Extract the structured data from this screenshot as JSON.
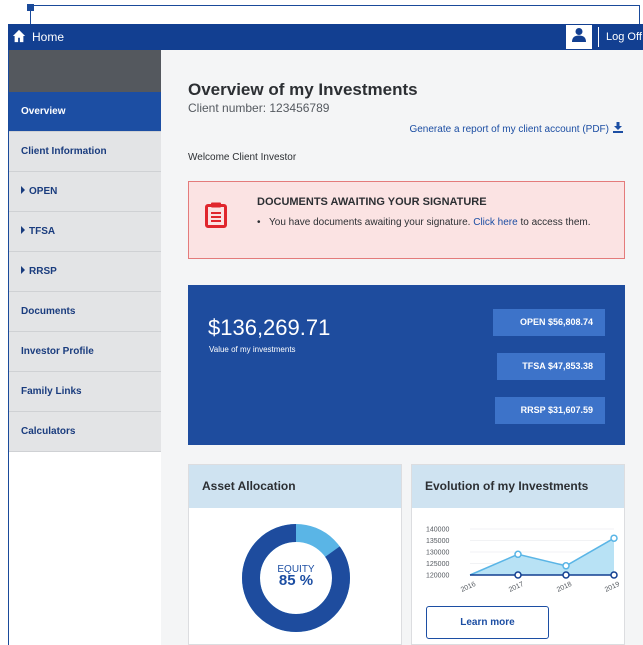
{
  "topbar": {
    "home_label": "Home",
    "logoff_label": "Log Off",
    "icon_home": "home-icon",
    "icon_user": "user-icon"
  },
  "sidebar": {
    "items": [
      {
        "label": "Overview",
        "active": true,
        "caret": false
      },
      {
        "label": "Client Information",
        "active": false,
        "caret": false
      },
      {
        "label": "OPEN",
        "active": false,
        "caret": true
      },
      {
        "label": "TFSA",
        "active": false,
        "caret": true
      },
      {
        "label": "RRSP",
        "active": false,
        "caret": true
      },
      {
        "label": "Documents",
        "active": false,
        "caret": false
      },
      {
        "label": "Investor Profile",
        "active": false,
        "caret": false
      },
      {
        "label": "Family Links",
        "active": false,
        "caret": false
      },
      {
        "label": "Calculators",
        "active": false,
        "caret": false
      }
    ]
  },
  "main": {
    "title": "Overview of my Investments",
    "client_number": "Client number: 123456789",
    "report_link": "Generate a report of my client account (PDF)",
    "welcome": "Welcome Client Investor"
  },
  "alert": {
    "title": "DOCUMENTS AWAITING YOUR SIGNATURE",
    "text_before": "You have documents awaiting your signature.",
    "link": "Click here",
    "text_after": "to access them."
  },
  "investments": {
    "total": "$136,269.71",
    "total_label": "Value of my investments",
    "accounts": [
      {
        "label": "OPEN $56,808.74"
      },
      {
        "label": "TFSA $47,853.38"
      },
      {
        "label": "RRSP $31,607.59"
      }
    ]
  },
  "asset_allocation": {
    "title": "Asset Allocation",
    "center_label": "EQUITY",
    "center_value": "85 %",
    "equity_fraction": 0.85
  },
  "evolution": {
    "title": "Evolution of my Investments",
    "learn_more": "Learn more"
  },
  "colors": {
    "brand_dark": "#123f91",
    "brand": "#1e4c9e",
    "accent_light": "#5ab5e6",
    "alert_red": "#e0262d"
  },
  "chart_data": {
    "type": "area",
    "x": [
      "2016",
      "2017",
      "2018",
      "2019"
    ],
    "yticks": [
      "140000",
      "135000",
      "130000",
      "125000",
      "120000"
    ],
    "ylim": [
      120000,
      140000
    ],
    "series": [
      {
        "values": [
          120000,
          129000,
          124000,
          136000
        ]
      },
      {
        "values": [
          120000,
          120000,
          120000,
          120000
        ]
      }
    ]
  }
}
